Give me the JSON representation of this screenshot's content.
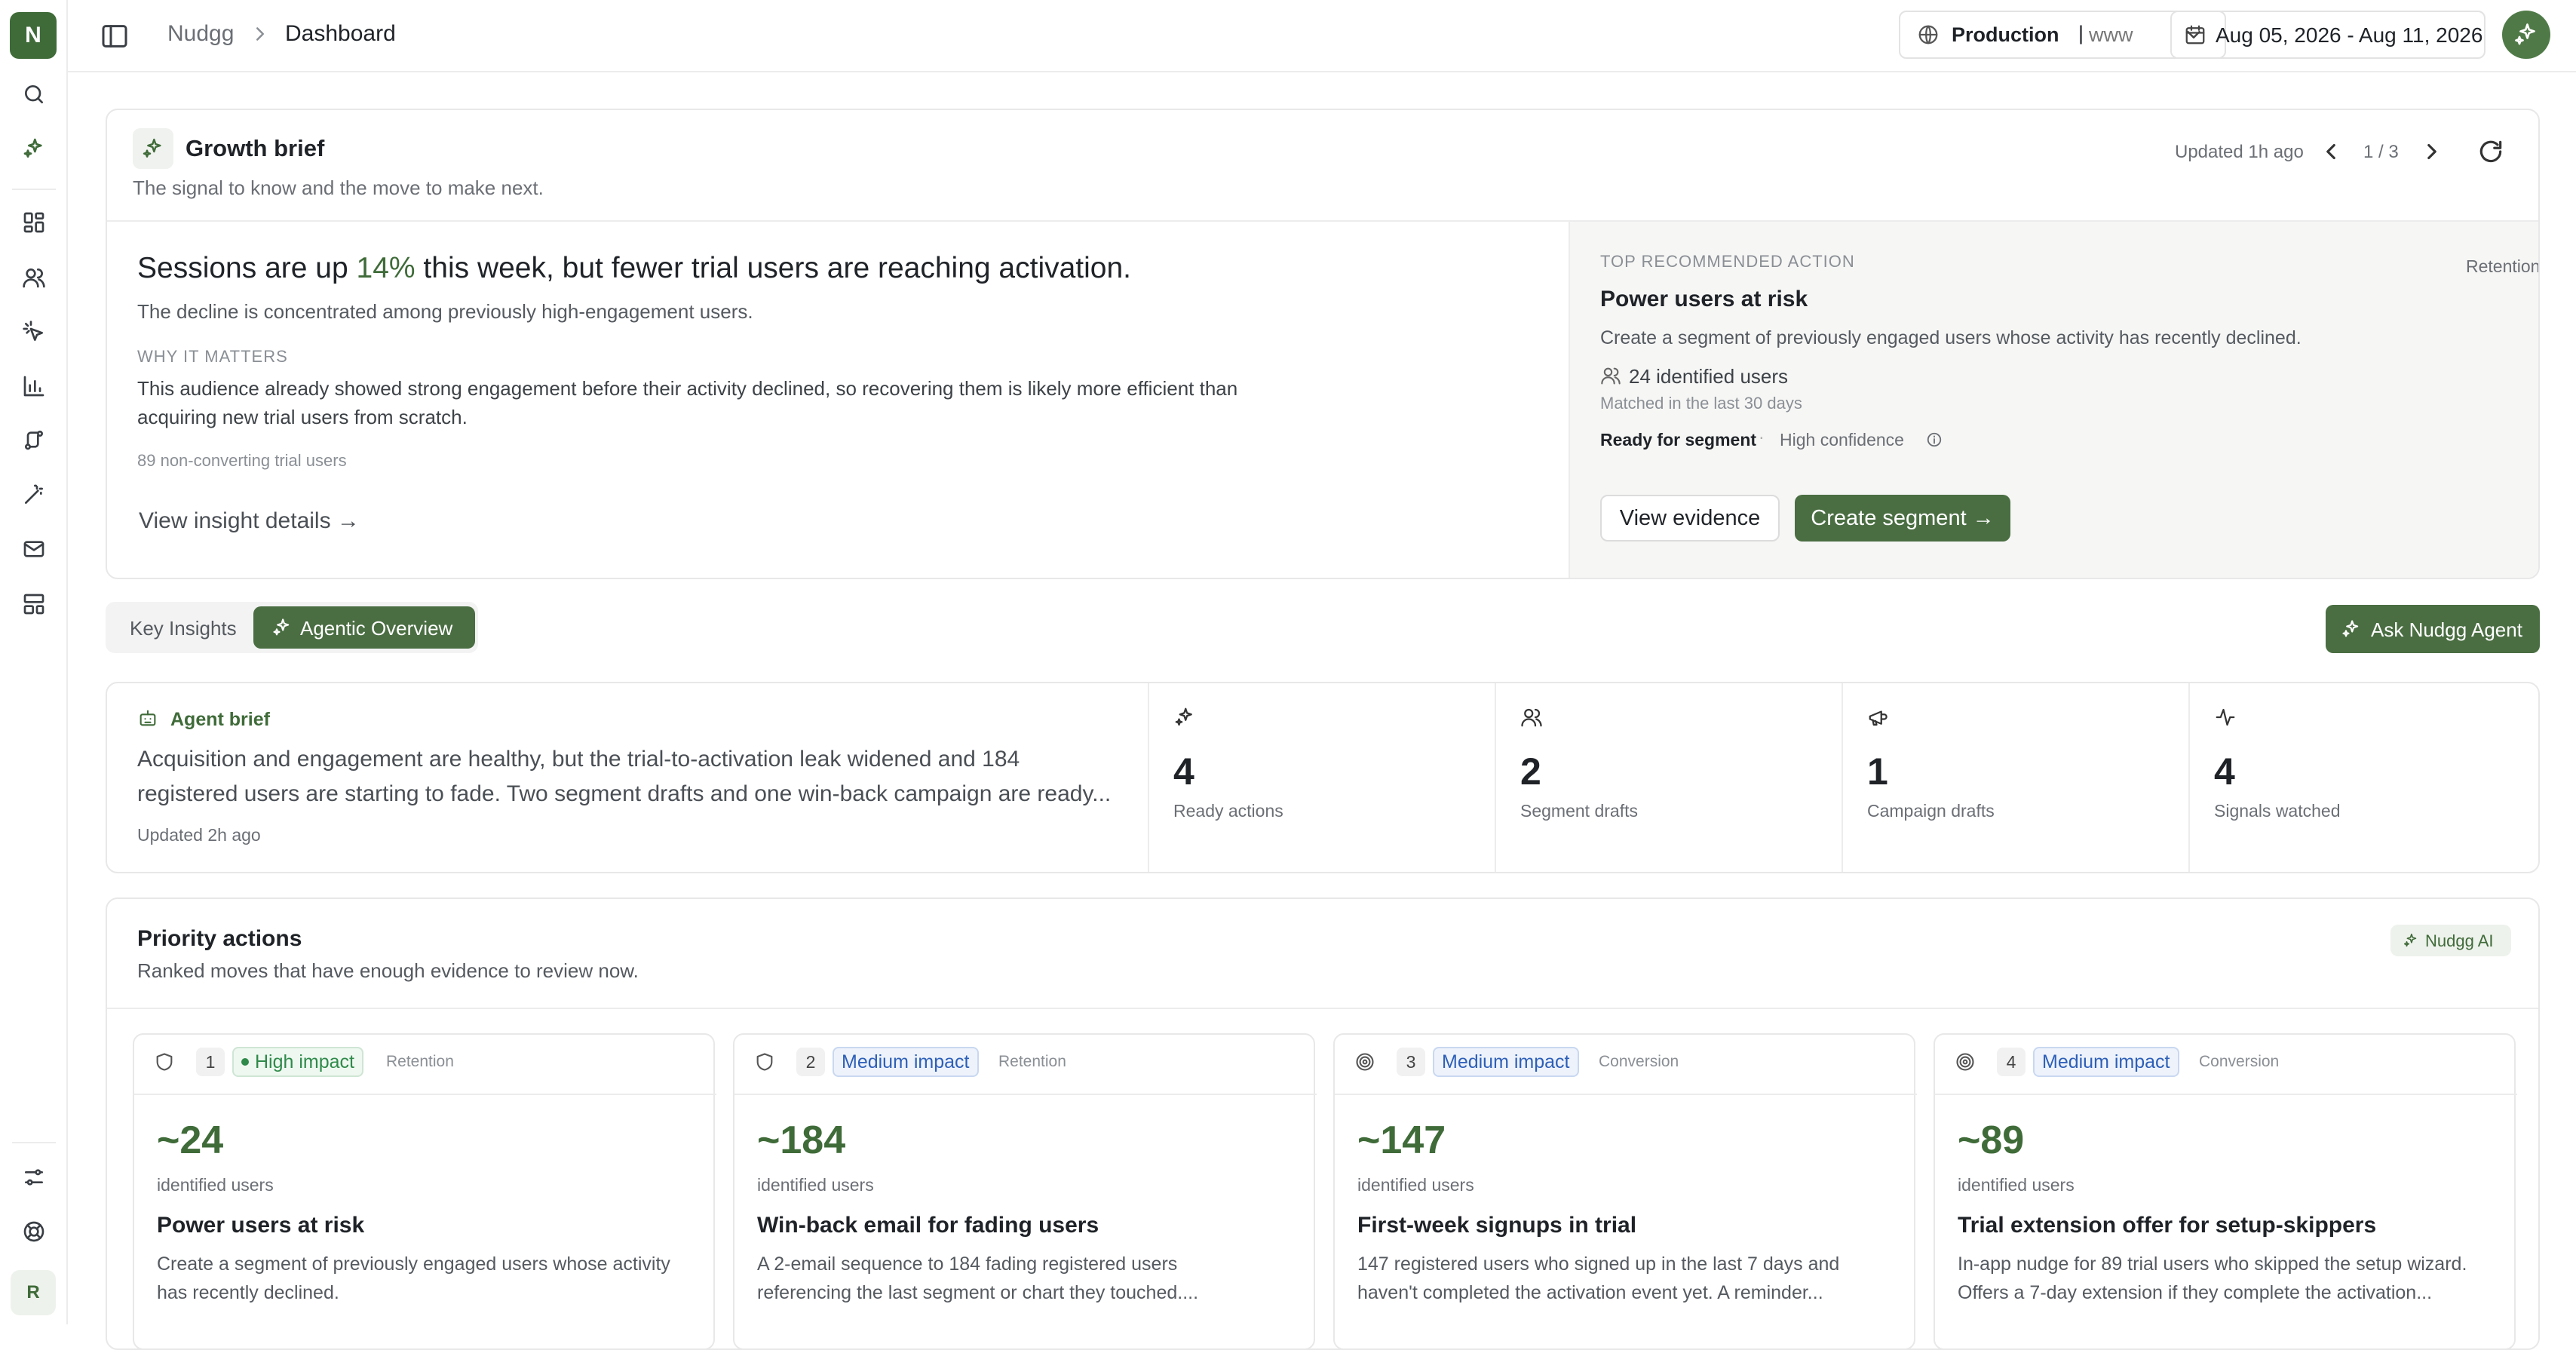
{
  "rail": {
    "logo_letter": "N",
    "user_initial": "R"
  },
  "header": {
    "breadcrumb_root": "Nudgg",
    "breadcrumb_current": "Dashboard",
    "environment": "Production",
    "site": "www",
    "date_range": "Aug 05, 2026 - Aug 11, 2026"
  },
  "brief": {
    "title": "Growth brief",
    "subtitle": "The signal to know and the move to make next.",
    "updated": "Updated 1h ago",
    "pager": "1 / 3",
    "headline_pre": "Sessions are up ",
    "headline_pct": "14%",
    "headline_post": " this week, but fewer trial users are reaching activation.",
    "detail": "The decline is concentrated among previously high-engagement users.",
    "why_label": "WHY IT MATTERS",
    "why_line1": "This audience already showed strong engagement before their activity declined, so recovering them is likely more efficient than",
    "why_line2": "acquiring new trial users from scratch.",
    "footnote": "89 non-converting trial users",
    "details_link": "View insight details →"
  },
  "recommended": {
    "label": "TOP RECOMMENDED ACTION",
    "tag": "Retention",
    "title": "Power users at risk",
    "description": "Create a segment of previously engaged users whose activity has recently declined.",
    "users": "24 identified users",
    "matched": "Matched in the last 30 days",
    "status": "Ready for segment",
    "confidence": "High confidence",
    "view_button": "View evidence",
    "create_button": "Create segment →"
  },
  "tabs": {
    "key_insights": "Key Insights",
    "agentic_overview": "Agentic Overview",
    "ask_agent": "Ask Nudgg Agent"
  },
  "agent": {
    "label": "Agent brief",
    "line1": "Acquisition and engagement are healthy, but the trial-to-activation leak widened and 184",
    "line2": "registered users are starting to fade. Two segment drafts and one win-back campaign are ready...",
    "updated": "Updated 2h ago",
    "stats": [
      {
        "value": "4",
        "label": "Ready actions",
        "icon": "sparkle-icon"
      },
      {
        "value": "2",
        "label": "Segment drafts",
        "icon": "users-icon"
      },
      {
        "value": "1",
        "label": "Campaign drafts",
        "icon": "megaphone-icon"
      },
      {
        "value": "4",
        "label": "Signals watched",
        "icon": "pulse-icon"
      }
    ]
  },
  "priority": {
    "title": "Priority actions",
    "subtitle": "Ranked moves that have enough evidence to review now.",
    "ai_badge": "Nudgg AI",
    "cards": [
      {
        "rank": "1",
        "impact": "High impact",
        "category": "Retention",
        "value": "~24",
        "unit": "identified users",
        "title": "Power users at risk",
        "desc1": "Create a segment of previously engaged users whose activity",
        "desc2": "has recently declined.",
        "icon": "shield-icon",
        "impact_color": "#2f8a4a"
      },
      {
        "rank": "2",
        "impact": "Medium impact",
        "category": "Retention",
        "value": "~184",
        "unit": "identified users",
        "title": "Win-back email for fading users",
        "desc1": "A 2-email sequence to 184 fading registered users",
        "desc2": "referencing the last segment or chart they touched....",
        "icon": "shield-icon",
        "impact_color": "#2d5fb8"
      },
      {
        "rank": "3",
        "impact": "Medium impact",
        "category": "Conversion",
        "value": "~147",
        "unit": "identified users",
        "title": "First-week signups in trial",
        "desc1": "147 registered users who signed up in the last 7 days and",
        "desc2": "haven't completed the activation event yet. A reminder...",
        "icon": "target-icon",
        "impact_color": "#2d5fb8"
      },
      {
        "rank": "4",
        "impact": "Medium impact",
        "category": "Conversion",
        "value": "~89",
        "unit": "identified users",
        "title": "Trial extension offer for setup-skippers",
        "desc1": "In-app nudge for 89 trial users who skipped the setup wizard.",
        "desc2": "Offers a 7-day extension if they complete the activation...",
        "icon": "target-icon",
        "impact_color": "#2d5fb8"
      }
    ]
  }
}
